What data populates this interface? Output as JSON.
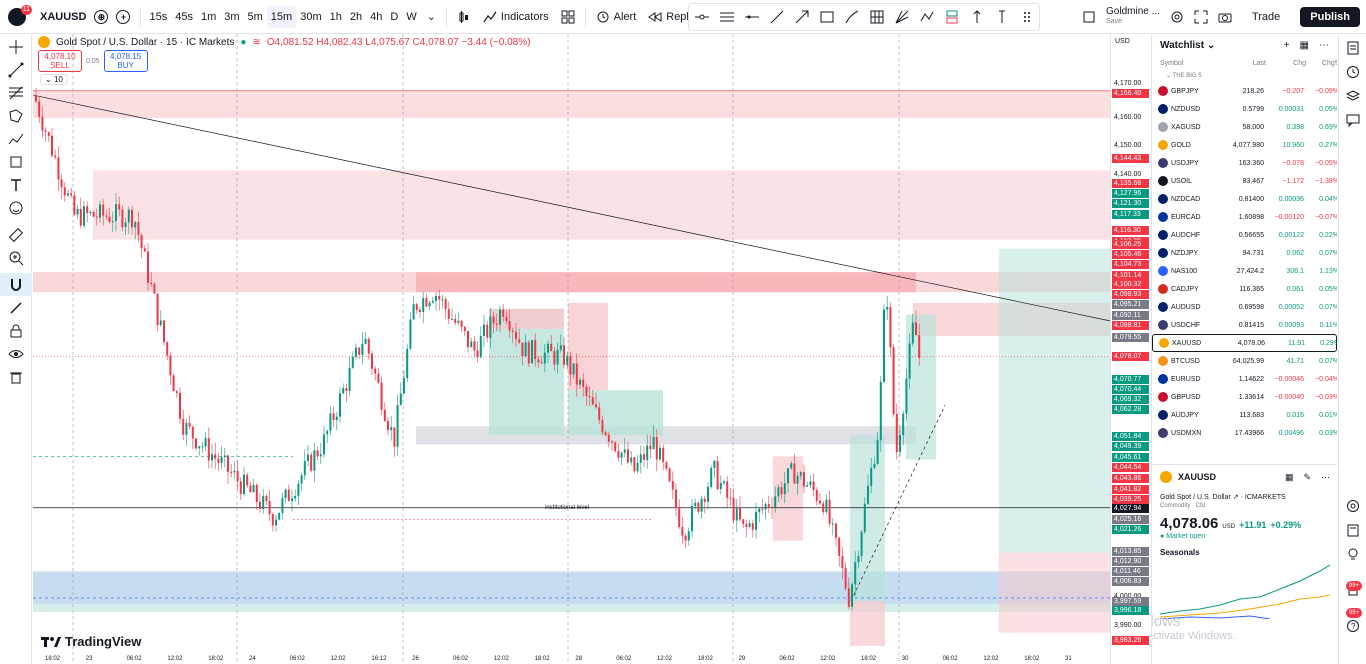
{
  "topbar": {
    "notifications": "11",
    "symbol": "XAUUSD",
    "timeframes": [
      "15s",
      "45s",
      "1m",
      "3m",
      "5m",
      "15m",
      "30m",
      "1h",
      "2h",
      "4h",
      "D",
      "W"
    ],
    "active_timeframe": "15m",
    "indicators_label": "Indicators",
    "alert_label": "Alert",
    "replay_label": "Replay",
    "layout_name": "Goldmine ...",
    "layout_status": "Save",
    "trade_label": "Trade",
    "publish_label": "Publish"
  },
  "chart": {
    "title": "Gold Spot / U.S. Dollar · 15 · IC Markets",
    "ohlc": {
      "o": "O4,081.52",
      "h": "H4,082.43",
      "l": "L4,075.67",
      "c": "C4,078.07",
      "chg": "−3.44 (−0.08%)"
    },
    "sell_price": "4,078.10",
    "sell_label": "SELL",
    "spread": "0.05",
    "buy_price": "4,078.15",
    "buy_label": "BUY",
    "indicator_count": "10",
    "institutional_label": "institutional level",
    "watermark": "TradingView",
    "candles_seed": "xauusd-15m",
    "colors": {
      "up": "#089981",
      "down": "#f23645",
      "supply": "#f7c8cc",
      "demand": "#b9e2da",
      "blue": "#6fa8dc"
    }
  },
  "price_axis": {
    "currency": "USD",
    "ticks": [
      "4,170.00",
      "4,160.00",
      "4,150.00",
      "4,140.00",
      "4,000.00",
      "3,990.00"
    ],
    "labels": [
      {
        "v": "4,166.40",
        "c": "#f23645"
      },
      {
        "v": "4,144.43",
        "c": "#f23645"
      },
      {
        "v": "4,135.68",
        "c": "#f23645"
      },
      {
        "v": "4,127.96",
        "c": "#089981"
      },
      {
        "v": "4,121.30",
        "c": "#089981"
      },
      {
        "v": "4,117.33",
        "c": "#089981"
      },
      {
        "v": "4,116.30",
        "c": "#f23645"
      },
      {
        "v": "4,110.30",
        "c": "#f23645"
      },
      {
        "v": "4,106.25",
        "c": "#f23645"
      },
      {
        "v": "4,105.46",
        "c": "#f23645"
      },
      {
        "v": "4,104.73",
        "c": "#f23645"
      },
      {
        "v": "4,101.14",
        "c": "#f23645"
      },
      {
        "v": "4,100.32",
        "c": "#f23645"
      },
      {
        "v": "4,098.93",
        "c": "#f23645"
      },
      {
        "v": "4,095.21",
        "c": "#787b86"
      },
      {
        "v": "4,092.11",
        "c": "#787b86"
      },
      {
        "v": "4,088.81",
        "c": "#f23645"
      },
      {
        "v": "4,079.55",
        "c": "#787b86"
      },
      {
        "v": "4,078.07",
        "c": "#f23645"
      },
      {
        "v": "4,070.77",
        "c": "#089981"
      },
      {
        "v": "4,070.44",
        "c": "#089981"
      },
      {
        "v": "4,069.32",
        "c": "#089981"
      },
      {
        "v": "4,062.28",
        "c": "#089981"
      },
      {
        "v": "4,051.84",
        "c": "#089981"
      },
      {
        "v": "4,049.39",
        "c": "#089981"
      },
      {
        "v": "4,045.61",
        "c": "#089981"
      },
      {
        "v": "4,044.54",
        "c": "#f23645"
      },
      {
        "v": "4,043.86",
        "c": "#f23645"
      },
      {
        "v": "4,041.82",
        "c": "#f23645"
      },
      {
        "v": "4,039.25",
        "c": "#f23645"
      },
      {
        "v": "4,027.94",
        "c": "#131722"
      },
      {
        "v": "4,025.16",
        "c": "#787b86"
      },
      {
        "v": "4,021.26",
        "c": "#089981"
      },
      {
        "v": "4,013.85",
        "c": "#787b86"
      },
      {
        "v": "4,012.90",
        "c": "#787b86"
      },
      {
        "v": "4,011.46",
        "c": "#787b86"
      },
      {
        "v": "4,006.83",
        "c": "#787b86"
      },
      {
        "v": "3,997.59",
        "c": "#787b86"
      },
      {
        "v": "3,996.18",
        "c": "#089981"
      },
      {
        "v": "3,983.26",
        "c": "#f23645"
      }
    ]
  },
  "time_axis": [
    "18:02",
    "23",
    "06:02",
    "12:02",
    "18:02",
    "24",
    "06:02",
    "12:02",
    "16:12",
    "26",
    "06:02",
    "12:02",
    "18:02",
    "28",
    "06:02",
    "12:02",
    "18:02",
    "29",
    "06:02",
    "12:02",
    "18:02",
    "30",
    "06:02",
    "12:02",
    "18:02",
    "31"
  ],
  "watchlist": {
    "title": "Watchlist",
    "columns": [
      "Symbol",
      "Last",
      "Chg",
      "Chg%"
    ],
    "group": "THE BIG 5",
    "rows": [
      {
        "sym": "GBPJPY",
        "last": "218.26",
        "chg": "−0.207",
        "pct": "−0.09%",
        "dir": "neg",
        "flag": "#c8102e"
      },
      {
        "sym": "NZDUSD",
        "last": "0.5799",
        "chg": "0.00031",
        "pct": "0.05%",
        "dir": "pos",
        "flag": "#012169"
      },
      {
        "sym": "XAGUSD",
        "last": "58.000",
        "chg": "0.398",
        "pct": "0.69%",
        "dir": "pos",
        "flag": "#9ea3ad"
      },
      {
        "sym": "GOLD",
        "last": "4,077.980",
        "chg": "10.960",
        "pct": "0.27%",
        "dir": "pos",
        "flag": "#f7a600"
      },
      {
        "sym": "USDJPY",
        "last": "163.360",
        "chg": "−0.078",
        "pct": "−0.05%",
        "dir": "neg",
        "flag": "#3c3b6e"
      },
      {
        "sym": "USOIL",
        "last": "83.467",
        "chg": "−1.172",
        "pct": "−1.38%",
        "dir": "neg",
        "flag": "#131722"
      },
      {
        "sym": "NZDCAD",
        "last": "0.81400",
        "chg": "0.00036",
        "pct": "0.04%",
        "dir": "pos",
        "flag": "#012169"
      },
      {
        "sym": "EURCAD",
        "last": "1.60898",
        "chg": "−0.00120",
        "pct": "−0.07%",
        "dir": "neg",
        "flag": "#003399"
      },
      {
        "sym": "AUDCHF",
        "last": "0.56655",
        "chg": "0.00122",
        "pct": "0.22%",
        "dir": "pos",
        "flag": "#012169"
      },
      {
        "sym": "NZDJPY",
        "last": "94.731",
        "chg": "0.062",
        "pct": "0.07%",
        "dir": "pos",
        "flag": "#012169"
      },
      {
        "sym": "NAS100",
        "last": "27,424.2",
        "chg": "306.1",
        "pct": "1.13%",
        "dir": "pos",
        "flag": "#2962ff"
      },
      {
        "sym": "CADJPY",
        "last": "116.365",
        "chg": "0.061",
        "pct": "0.05%",
        "dir": "pos",
        "flag": "#d52b1e"
      },
      {
        "sym": "AUDUSD",
        "last": "0.69598",
        "chg": "0.00052",
        "pct": "0.07%",
        "dir": "pos",
        "flag": "#012169"
      },
      {
        "sym": "USDCHF",
        "last": "0.81415",
        "chg": "0.00093",
        "pct": "0.11%",
        "dir": "pos",
        "flag": "#3c3b6e"
      },
      {
        "sym": "XAUUSD",
        "last": "4,078.06",
        "chg": "11.91",
        "pct": "0.29%",
        "dir": "pos",
        "flag": "#f7a600",
        "selected": true
      },
      {
        "sym": "BTCUSD",
        "last": "64,025.99",
        "chg": "41.71",
        "pct": "0.07%",
        "dir": "pos",
        "flag": "#f7931a"
      },
      {
        "sym": "EURUSD",
        "last": "1.14622",
        "chg": "−0.00046",
        "pct": "−0.04%",
        "dir": "neg",
        "flag": "#003399"
      },
      {
        "sym": "GBPUSD",
        "last": "1.33614",
        "chg": "−0.00040",
        "pct": "−0.03%",
        "dir": "neg",
        "flag": "#c8102e"
      },
      {
        "sym": "AUDJPY",
        "last": "113.683",
        "chg": "0.016",
        "pct": "0.01%",
        "dir": "pos",
        "flag": "#012169"
      },
      {
        "sym": "USDMXN",
        "last": "17.43966",
        "chg": "0.00496",
        "pct": "0.03%",
        "dir": "pos",
        "flag": "#3c3b6e"
      }
    ],
    "detail": {
      "symbol": "XAUUSD",
      "name": "Gold Spot / U.S. Dollar",
      "exchange": "ICMARKETS",
      "category": "Commodity · Cfd",
      "price": "4,078.06",
      "currency": "USD",
      "change": "+11.91",
      "change_pct": "+0.29%",
      "market_status": "Market open",
      "seasonals": "Seasonals"
    },
    "activate_title": "Activate Windows",
    "activate_sub": "Go to Settings to activate Windows."
  },
  "rightbar": {
    "badge1": "99+",
    "badge2": "99+"
  }
}
